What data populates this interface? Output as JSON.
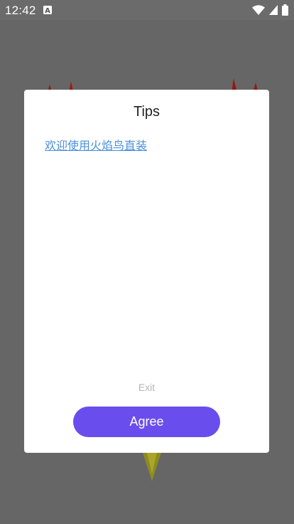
{
  "status_bar": {
    "time": "12:42",
    "notification_icon": "a-badge-icon",
    "icons": [
      "wifi-icon",
      "signal-icon",
      "battery-icon"
    ]
  },
  "dialog": {
    "title": "Tips",
    "link_text": "欢迎使用火焰鸟直装",
    "exit_label": "Exit",
    "agree_label": "Agree"
  },
  "colors": {
    "accent": "#6a4ded",
    "link": "#4a90d9",
    "overlay": "#666666"
  }
}
